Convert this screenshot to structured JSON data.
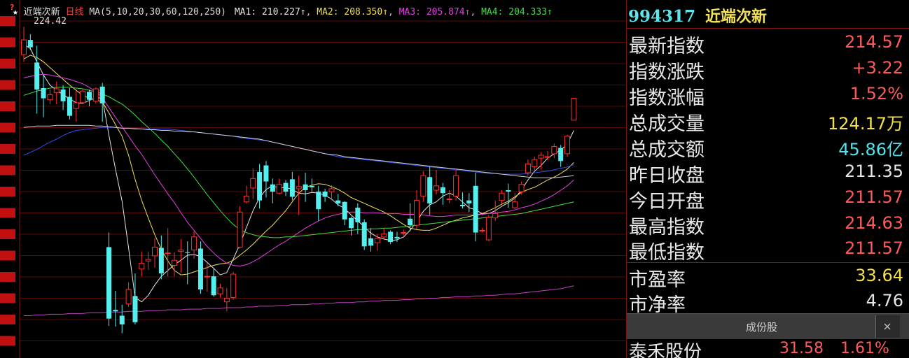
{
  "legend": {
    "star": "★",
    "name": "近端次新",
    "period": "日线",
    "ma_params": "MA(5,10,20,30,60,120,250)",
    "ma": [
      {
        "label": "MA1:",
        "value": "210.227↑",
        "color": "#e6e6e6"
      },
      {
        "label": "MA2:",
        "value": "208.350↑",
        "color": "#f0e05a"
      },
      {
        "label": "MA3:",
        "value": "205.874↑",
        "color": "#e040e0"
      },
      {
        "label": "MA4:",
        "value": "204.333↑",
        "color": "#40e040"
      }
    ],
    "high_label": "224.42"
  },
  "header": {
    "code": "994317",
    "name": "近端次新"
  },
  "quote": [
    {
      "label": "最新指数",
      "value": "214.57",
      "color": "red"
    },
    {
      "label": "指数涨跌",
      "value": "+3.22",
      "color": "red"
    },
    {
      "label": "指数涨幅",
      "value": "1.52%",
      "color": "red"
    },
    {
      "label": "总成交量",
      "value": "124.17万",
      "color": "yel"
    },
    {
      "label": "总成交额",
      "value": "45.86亿",
      "color": "cyan"
    },
    {
      "label": "昨日收盘",
      "value": "211.35",
      "color": "wht"
    },
    {
      "label": "今日开盘",
      "value": "211.57",
      "color": "red"
    },
    {
      "label": "最高指数",
      "value": "214.63",
      "color": "red"
    },
    {
      "label": "最低指数",
      "value": "211.57",
      "color": "red"
    }
  ],
  "valuation": [
    {
      "label": "市盈率",
      "value": "33.64",
      "color": "yel"
    },
    {
      "label": "市净率",
      "value": "4.76",
      "color": "wht"
    }
  ],
  "tab": {
    "label": "成份股"
  },
  "constituent": {
    "name": "泰禾股份",
    "price": "31.58",
    "pct": "1.61%"
  },
  "chart_data": {
    "type": "candlestick",
    "candles": [
      [
        220.6,
        224.4,
        219.6,
        222.6
      ],
      [
        222.6,
        223.4,
        221.2,
        221.6
      ],
      [
        219.5,
        221.8,
        212.5,
        215.8
      ],
      [
        216.0,
        217.8,
        212.0,
        214.6
      ],
      [
        214.4,
        215.8,
        213.8,
        215.1
      ],
      [
        215.4,
        216.9,
        213.8,
        215.9
      ],
      [
        215.8,
        216.4,
        213.0,
        214.2
      ],
      [
        214.8,
        216.0,
        211.7,
        212.2
      ],
      [
        213.2,
        215.6,
        211.4,
        214.0
      ],
      [
        214.0,
        215.8,
        213.8,
        215.6
      ],
      [
        215.5,
        215.8,
        213.5,
        214.4
      ],
      [
        214.2,
        216.1,
        213.9,
        215.9
      ],
      [
        216.2,
        216.7,
        211.4,
        213.9
      ],
      [
        194.2,
        196.2,
        183.4,
        184.4
      ],
      [
        185.6,
        188.2,
        183.3,
        185.4
      ],
      [
        184.8,
        186.3,
        182.4,
        183.6
      ],
      [
        186.4,
        189.4,
        186.0,
        188.4
      ],
      [
        187.5,
        190.6,
        183.6,
        183.9
      ],
      [
        191.2,
        193.6,
        190.2,
        192.0
      ],
      [
        192.3,
        193.6,
        191.1,
        192.5
      ],
      [
        193.0,
        195.4,
        191.4,
        194.2
      ],
      [
        194.1,
        195.8,
        189.8,
        190.6
      ],
      [
        193.4,
        196.8,
        190.2,
        193.4
      ],
      [
        191.7,
        193.5,
        190.2,
        192.4
      ],
      [
        193.6,
        195.3,
        190.7,
        193.8
      ],
      [
        193.5,
        195.0,
        189.1,
        193.4
      ],
      [
        193.8,
        196.4,
        192.6,
        195.6
      ],
      [
        194.0,
        195.0,
        187.8,
        188.4
      ],
      [
        190.1,
        192.0,
        188.1,
        190.2
      ],
      [
        190.2,
        191.2,
        187.4,
        187.6
      ],
      [
        187.8,
        189.2,
        187.3,
        188.6
      ],
      [
        186.7,
        188.6,
        185.4,
        187.2
      ],
      [
        187.3,
        190.8,
        187.0,
        190.5
      ],
      [
        194.2,
        199.8,
        194.0,
        199.0
      ],
      [
        200.4,
        202.6,
        200.2,
        201.2
      ],
      [
        202.3,
        205.0,
        200.8,
        203.6
      ],
      [
        204.5,
        205.6,
        199.5,
        200.6
      ],
      [
        205.4,
        206.0,
        201.0,
        203.2
      ],
      [
        202.8,
        203.6,
        200.2,
        201.8
      ],
      [
        201.6,
        203.6,
        201.4,
        202.8
      ],
      [
        203.0,
        203.4,
        201.2,
        201.8
      ],
      [
        203.5,
        204.5,
        200.6,
        201.1
      ],
      [
        202.2,
        204.0,
        198.6,
        202.5
      ],
      [
        202.8,
        204.4,
        200.4,
        202.0
      ],
      [
        202.6,
        203.6,
        201.8,
        202.4
      ],
      [
        201.8,
        202.6,
        197.8,
        199.4
      ],
      [
        201.8,
        202.2,
        200.4,
        201.1
      ],
      [
        201.8,
        202.7,
        200.6,
        202.2
      ],
      [
        200.6,
        201.5,
        199.8,
        200.2
      ],
      [
        200.4,
        200.5,
        197.2,
        198.0
      ],
      [
        198.2,
        198.4,
        195.8,
        196.8
      ],
      [
        199.6,
        200.2,
        196.0,
        197.6
      ],
      [
        197.6,
        198.0,
        193.8,
        194.3
      ],
      [
        195.4,
        196.8,
        193.6,
        194.4
      ],
      [
        194.8,
        196.0,
        193.7,
        195.4
      ],
      [
        195.6,
        196.8,
        195.2,
        196.0
      ],
      [
        196.3,
        196.5,
        194.6,
        194.9
      ],
      [
        195.6,
        196.3,
        194.9,
        195.4
      ],
      [
        196.2,
        196.6,
        195.8,
        196.2
      ],
      [
        198.1,
        200.2,
        196.4,
        197.2
      ],
      [
        197.2,
        202.0,
        196.7,
        200.6
      ],
      [
        201.2,
        204.6,
        200.4,
        204.0
      ],
      [
        203.8,
        205.2,
        198.6,
        200.2
      ],
      [
        202.0,
        204.8,
        201.4,
        202.6
      ],
      [
        202.4,
        203.0,
        200.0,
        201.6
      ],
      [
        200.8,
        202.0,
        200.2,
        200.8
      ],
      [
        201.2,
        205.0,
        200.6,
        204.0
      ],
      [
        200.0,
        201.7,
        199.5,
        199.8
      ],
      [
        200.6,
        201.6,
        199.0,
        200.2
      ],
      [
        202.6,
        204.4,
        195.0,
        196.2
      ],
      [
        196.5,
        196.8,
        196.2,
        196.5
      ],
      [
        195.2,
        198.6,
        195.0,
        198.3
      ],
      [
        198.2,
        200.6,
        197.8,
        198.8
      ],
      [
        200.6,
        202.0,
        200.2,
        201.6
      ],
      [
        202.0,
        202.9,
        199.6,
        201.8
      ],
      [
        199.6,
        201.6,
        199.4,
        200.4
      ],
      [
        201.8,
        203.2,
        201.4,
        202.8
      ],
      [
        204.4,
        206.2,
        204.0,
        205.6
      ],
      [
        205.2,
        206.6,
        204.8,
        206.2
      ],
      [
        206.4,
        207.2,
        204.8,
        206.8
      ],
      [
        206.6,
        207.4,
        206.1,
        206.6
      ],
      [
        207.0,
        208.4,
        206.4,
        208.0
      ],
      [
        207.8,
        208.2,
        205.2,
        206.0
      ],
      [
        207.0,
        209.6,
        206.6,
        209.4
      ],
      [
        211.6,
        214.6,
        211.6,
        214.6
      ]
    ],
    "ma_series": [
      {
        "name": "MA1",
        "color": "#e6e6e6",
        "values": [
          222.0,
          221.4,
          219.6,
          217.8,
          216.4,
          215.7,
          215.1,
          214.5,
          214.0,
          213.9,
          214.3,
          214.7,
          214.6,
          209.5,
          204.9,
          200.5,
          194.1,
          187.3,
          186.7,
          187.6,
          189.0,
          190.2,
          191.0,
          191.8,
          192.4,
          193.1,
          193.2,
          192.9,
          192.1,
          191.3,
          190.4,
          190.7,
          192.6,
          194.6,
          196.9,
          199.2,
          201.0,
          202.1,
          202.6,
          202.3,
          202.4,
          202.1,
          201.6,
          201.5,
          201.7,
          201.6,
          201.3,
          200.8,
          200.0,
          199.5,
          198.6,
          197.8,
          197.0,
          196.1,
          195.6,
          195.3,
          195.1,
          195.2,
          195.6,
          196.5,
          197.7,
          199.1,
          200.0,
          200.4,
          201.2,
          201.6,
          201.2,
          200.4,
          199.6,
          199.3,
          198.8,
          198.8,
          199.2,
          199.8,
          200.3,
          200.9,
          202.0,
          203.4,
          204.6,
          205.4,
          206.4,
          207.0,
          207.5,
          208.3,
          210.2
        ]
      },
      {
        "name": "MA2",
        "color": "#f0e05a",
        "values": [
          220.0,
          220.5,
          220.2,
          219.6,
          218.8,
          218.0,
          217.2,
          216.4,
          215.7,
          215.0,
          214.6,
          214.4,
          214.1,
          212.6,
          211.0,
          209.4,
          206.8,
          203.5,
          200.6,
          198.2,
          195.9,
          193.9,
          192.3,
          191.0,
          190.4,
          190.5,
          190.8,
          191.1,
          191.4,
          191.7,
          191.9,
          192.0,
          192.4,
          193.1,
          193.8,
          194.6,
          195.5,
          196.4,
          197.2,
          198.2,
          199.2,
          200.4,
          201.6,
          202.4,
          202.7,
          202.9,
          202.8,
          202.5,
          202.1,
          201.6,
          201.0,
          200.6,
          200.2,
          199.8,
          199.4,
          199.0,
          198.5,
          197.9,
          197.3,
          196.8,
          196.6,
          196.5,
          196.5,
          196.8,
          197.2,
          197.6,
          197.9,
          198.2,
          198.4,
          198.6,
          198.8,
          199.2,
          199.6,
          200.1,
          200.5,
          201.1,
          201.7,
          202.1,
          202.4,
          202.9,
          203.4,
          203.8,
          204.3,
          204.9,
          205.8
        ]
      },
      {
        "name": "MA3",
        "color": "#e040e0",
        "values": [
          217.4,
          217.6,
          217.8,
          217.9,
          217.8,
          217.6,
          217.4,
          217.2,
          216.9,
          216.6,
          216.1,
          215.5,
          214.7,
          213.3,
          212.0,
          210.7,
          209.4,
          208.1,
          206.9,
          205.5,
          204.1,
          202.8,
          201.5,
          200.3,
          198.9,
          197.6,
          196.5,
          195.4,
          194.3,
          193.4,
          192.6,
          192.0,
          191.7,
          191.6,
          191.8,
          192.2,
          192.7,
          193.3,
          193.9,
          194.5,
          195.0,
          195.6,
          196.2,
          196.8,
          197.3,
          197.8,
          198.2,
          198.5,
          198.7,
          198.9,
          199.0,
          199.0,
          198.9,
          198.9,
          198.9,
          198.8,
          198.8,
          198.8,
          198.7,
          198.7,
          198.7,
          198.6,
          198.5,
          198.4,
          198.4,
          198.5,
          198.6,
          198.6,
          198.6,
          198.6,
          198.7,
          198.8,
          198.9,
          199.0,
          199.1,
          199.3,
          199.6,
          199.8,
          200.1,
          200.5,
          200.9,
          201.4,
          202.0,
          202.6,
          203.4
        ]
      },
      {
        "name": "MA4",
        "color": "#40e040",
        "values": [
          215.0,
          215.3,
          215.6,
          215.8,
          216.0,
          216.1,
          216.1,
          216.1,
          216.0,
          215.9,
          215.7,
          215.5,
          215.2,
          214.8,
          214.3,
          213.8,
          213.1,
          212.3,
          211.4,
          210.6,
          209.8,
          208.9,
          208.0,
          207.0,
          206.0,
          204.9,
          203.8,
          202.6,
          201.4,
          200.3,
          199.2,
          198.2,
          197.3,
          196.6,
          196.2,
          195.9,
          195.7,
          195.6,
          195.5,
          195.5,
          195.6,
          195.6,
          195.7,
          195.8,
          195.9,
          196.0,
          196.1,
          196.2,
          196.3,
          196.4,
          196.5,
          196.6,
          196.6,
          196.7,
          196.7,
          196.8,
          196.8,
          196.9,
          197.0,
          197.1,
          197.2,
          197.3,
          197.4,
          197.5,
          197.6,
          197.7,
          197.8,
          197.9,
          198.0,
          198.1,
          198.2,
          198.3,
          198.4,
          198.5,
          198.6,
          198.7,
          198.8,
          199.0,
          199.2,
          199.4,
          199.6,
          199.8,
          200.0,
          200.2,
          200.4
        ]
      },
      {
        "name": "MA5",
        "color": "#3050e8",
        "values": [
          206.8,
          207.2,
          207.6,
          208.1,
          208.6,
          209.0,
          209.5,
          209.9,
          210.2,
          210.3,
          210.4,
          210.5,
          210.6,
          210.6,
          210.6,
          210.5,
          210.5,
          210.5,
          210.4,
          210.4,
          210.4,
          210.4,
          210.4,
          210.3,
          210.2,
          210.1,
          210.0,
          209.9,
          209.8,
          209.7,
          209.6,
          209.5,
          209.4,
          209.2,
          209.1,
          209.0,
          208.9,
          208.8,
          208.6,
          208.4,
          208.2,
          208.0,
          207.8,
          207.6,
          207.4,
          207.2,
          207.0,
          206.8,
          206.6,
          206.5,
          206.4,
          206.3,
          206.2,
          206.1,
          206.0,
          205.9,
          205.8,
          205.7,
          205.6,
          205.5,
          205.4,
          205.3,
          205.2,
          205.1,
          205.0,
          204.9,
          204.8,
          204.7,
          204.6,
          204.5,
          204.4,
          204.3,
          204.3,
          204.2,
          204.2,
          204.2,
          204.2,
          204.3,
          204.4,
          204.5,
          204.6,
          204.8,
          205.0,
          205.2,
          205.5
        ]
      },
      {
        "name": "MA6",
        "color": "#cfcfcf",
        "values": [
          210.6,
          210.7,
          210.8,
          210.8,
          210.8,
          210.9,
          210.9,
          210.9,
          210.9,
          210.9,
          210.9,
          210.8,
          210.8,
          210.7,
          210.6,
          210.5,
          210.5,
          210.4,
          210.4,
          210.3,
          210.3,
          210.2,
          210.2,
          210.1,
          210.1,
          210.0,
          210.0,
          209.9,
          209.8,
          209.7,
          209.6,
          209.5,
          209.4,
          209.3,
          209.2,
          209.1,
          209.0,
          208.8,
          208.6,
          208.4,
          208.2,
          208.0,
          207.8,
          207.6,
          207.4,
          207.2,
          207.0,
          206.9,
          206.8,
          206.6,
          206.5,
          206.4,
          206.3,
          206.2,
          206.1,
          206.0,
          205.9,
          205.8,
          205.7,
          205.6,
          205.5,
          205.4,
          205.3,
          205.2,
          205.1,
          205.0,
          204.9,
          204.8,
          204.7,
          204.6,
          204.5,
          204.4,
          204.3,
          204.2,
          204.1,
          204.0,
          203.9,
          203.8,
          203.7,
          203.7,
          203.7,
          203.7,
          203.8,
          203.9,
          204.0
        ]
      },
      {
        "name": "MA7",
        "color": "#c040c0",
        "values": [
          184.8,
          184.8,
          184.9,
          184.9,
          185.0,
          185.0,
          185.0,
          185.1,
          185.1,
          185.1,
          185.2,
          185.2,
          185.2,
          185.3,
          185.3,
          185.3,
          185.4,
          185.4,
          185.4,
          185.5,
          185.5,
          185.5,
          185.6,
          185.6,
          185.6,
          185.7,
          185.7,
          185.7,
          185.8,
          185.8,
          185.8,
          185.9,
          185.9,
          185.9,
          186.0,
          186.0,
          186.1,
          186.1,
          186.1,
          186.2,
          186.2,
          186.3,
          186.3,
          186.3,
          186.4,
          186.4,
          186.5,
          186.5,
          186.6,
          186.6,
          186.6,
          186.7,
          186.7,
          186.8,
          186.8,
          186.9,
          186.9,
          186.9,
          187.0,
          187.0,
          187.1,
          187.1,
          187.2,
          187.2,
          187.3,
          187.3,
          187.4,
          187.4,
          187.4,
          187.5,
          187.5,
          187.6,
          187.6,
          187.7,
          187.8,
          187.8,
          187.9,
          188.0,
          188.1,
          188.2,
          188.3,
          188.4,
          188.5,
          188.7,
          188.9
        ]
      }
    ]
  }
}
